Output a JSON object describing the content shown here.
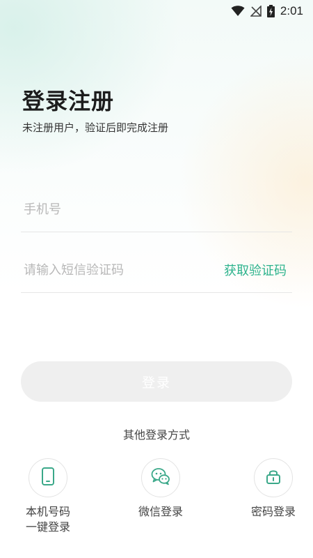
{
  "status_bar": {
    "time": "2:01",
    "icons": [
      "wifi-icon",
      "no-signal-icon",
      "battery-charging-icon"
    ]
  },
  "header": {
    "title": "登录注册",
    "subtitle": "未注册用户，验证后即完成注册"
  },
  "form": {
    "phone_placeholder": "手机号",
    "phone_value": "",
    "code_placeholder": "请输入短信验证码",
    "code_value": "",
    "get_code_label": "获取验证码",
    "login_label": "登录"
  },
  "other_login": {
    "title": "其他登录方式",
    "options": [
      {
        "icon": "phone-icon",
        "line1": "本机号码",
        "line2": "一键登录"
      },
      {
        "icon": "wechat-icon",
        "line1": "微信登录",
        "line2": ""
      },
      {
        "icon": "lock-icon",
        "line1": "密码登录",
        "line2": ""
      }
    ]
  },
  "colors": {
    "accent": "#2db38d",
    "button_disabled": "#efefef",
    "icon": "#3aa889"
  }
}
